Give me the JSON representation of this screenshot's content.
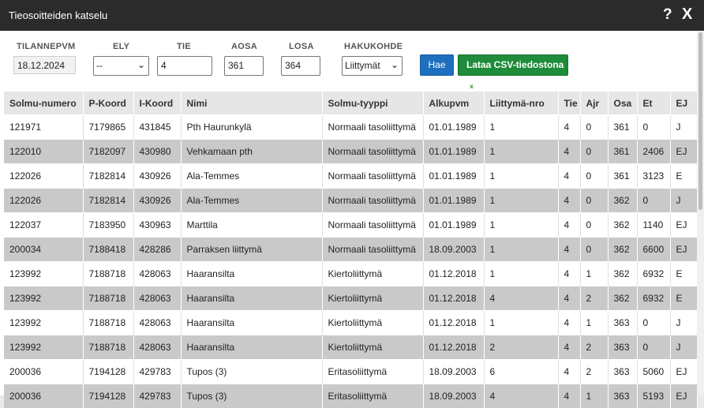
{
  "window": {
    "title": "Tieosoitteiden katselu",
    "help_icon": "?",
    "close_icon": "X"
  },
  "filters": {
    "tilannepvm": {
      "label": "TILANNEPVM",
      "value": "18.12.2024"
    },
    "ely": {
      "label": "ELY",
      "value": "--"
    },
    "tie": {
      "label": "TIE",
      "value": "4"
    },
    "aosa": {
      "label": "AOSA",
      "value": "361"
    },
    "losa": {
      "label": "LOSA",
      "value": "364"
    },
    "hakukohde": {
      "label": "HAKUKOHDE",
      "value": "Liittymät"
    },
    "search_label": "Hae",
    "csv_label": "Lataa CSV-tiedostona",
    "csv_icon": "x"
  },
  "table": {
    "columns": [
      "Solmu-numero",
      "P-Koord",
      "I-Koord",
      "Nimi",
      "Solmu-tyyppi",
      "Alkupvm",
      "Liittymä-nro",
      "Tie",
      "Ajr",
      "Osa",
      "Et",
      "EJ"
    ],
    "rows": [
      [
        "121971",
        "7179865",
        "431845",
        "Pth Haurunkylä",
        "Normaali tasoliittymä",
        "01.01.1989",
        "1",
        "4",
        "0",
        "361",
        "0",
        "J"
      ],
      [
        "122010",
        "7182097",
        "430980",
        "Vehkamaan pth",
        "Normaali tasoliittymä",
        "01.01.1989",
        "1",
        "4",
        "0",
        "361",
        "2406",
        "EJ"
      ],
      [
        "122026",
        "7182814",
        "430926",
        "Ala-Temmes",
        "Normaali tasoliittymä",
        "01.01.1989",
        "1",
        "4",
        "0",
        "361",
        "3123",
        "E"
      ],
      [
        "122026",
        "7182814",
        "430926",
        "Ala-Temmes",
        "Normaali tasoliittymä",
        "01.01.1989",
        "1",
        "4",
        "0",
        "362",
        "0",
        "J"
      ],
      [
        "122037",
        "7183950",
        "430963",
        "Marttila",
        "Normaali tasoliittymä",
        "01.01.1989",
        "1",
        "4",
        "0",
        "362",
        "1140",
        "EJ"
      ],
      [
        "200034",
        "7188418",
        "428286",
        "Parraksen liittymä",
        "Normaali tasoliittymä",
        "18.09.2003",
        "1",
        "4",
        "0",
        "362",
        "6600",
        "EJ"
      ],
      [
        "123992",
        "7188718",
        "428063",
        "Haaransilta",
        "Kiertoliittymä",
        "01.12.2018",
        "1",
        "4",
        "1",
        "362",
        "6932",
        "E"
      ],
      [
        "123992",
        "7188718",
        "428063",
        "Haaransilta",
        "Kiertoliittymä",
        "01.12.2018",
        "4",
        "4",
        "2",
        "362",
        "6932",
        "E"
      ],
      [
        "123992",
        "7188718",
        "428063",
        "Haaransilta",
        "Kiertoliittymä",
        "01.12.2018",
        "1",
        "4",
        "1",
        "363",
        "0",
        "J"
      ],
      [
        "123992",
        "7188718",
        "428063",
        "Haaransilta",
        "Kiertoliittymä",
        "01.12.2018",
        "2",
        "4",
        "2",
        "363",
        "0",
        "J"
      ],
      [
        "200036",
        "7194128",
        "429783",
        "Tupos (3)",
        "Eritasoliittymä",
        "18.09.2003",
        "6",
        "4",
        "2",
        "363",
        "5060",
        "EJ"
      ],
      [
        "200036",
        "7194128",
        "429783",
        "Tupos (3)",
        "Eritasoliittymä",
        "18.09.2003",
        "4",
        "4",
        "1",
        "363",
        "5193",
        "EJ"
      ]
    ]
  }
}
